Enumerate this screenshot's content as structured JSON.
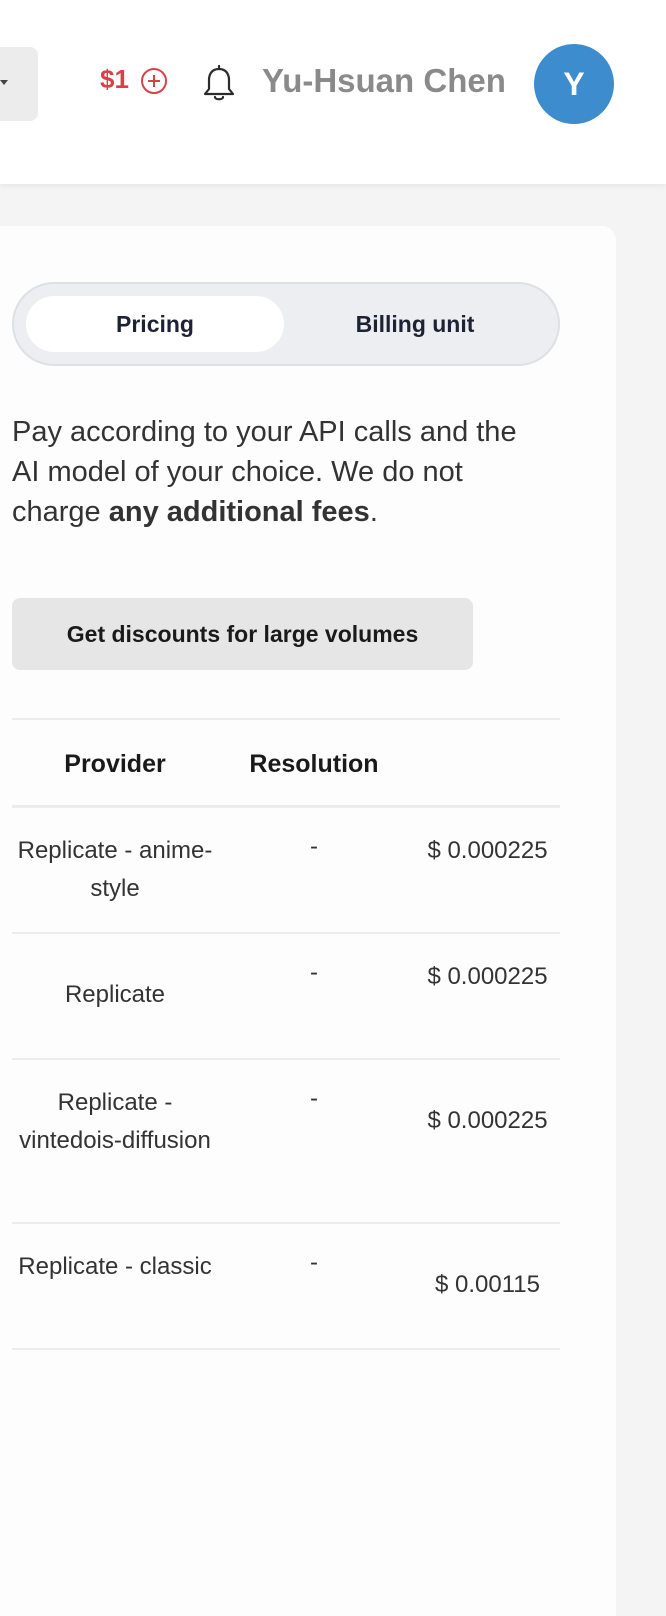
{
  "header": {
    "balance": "$1",
    "user_name": "Yu-Hsuan Chen",
    "avatar_initial": "Y",
    "icons": [
      "plus-circle-icon",
      "bell-icon",
      "chevron-down-icon"
    ]
  },
  "pricing_card": {
    "tabs": [
      {
        "label": "Pricing",
        "active": true
      },
      {
        "label": "Billing unit",
        "active": false
      }
    ],
    "description_prefix": "Pay according to your API calls and the AI model of your choice. We do not charge ",
    "description_emphasis": "any additional fees",
    "description_suffix": ".",
    "discount_button_label": "Get discounts for large volumes"
  },
  "table": {
    "columns": [
      "Provider",
      "Resolution",
      ""
    ],
    "rows": [
      {
        "provider": "Replicate - anime-style",
        "resolution": "-",
        "price": "$ 0.000225"
      },
      {
        "provider": "Replicate",
        "resolution": "-",
        "price": "$ 0.000225"
      },
      {
        "provider": "Replicate - vintedois-diffusion",
        "resolution": "-",
        "price": "$ 0.000225"
      },
      {
        "provider": "Replicate - classic",
        "resolution": "-",
        "price": "$ 0.00115"
      }
    ]
  },
  "colors": {
    "accent_red": "#d8414a",
    "avatar_blue": "#3d8ccd"
  }
}
